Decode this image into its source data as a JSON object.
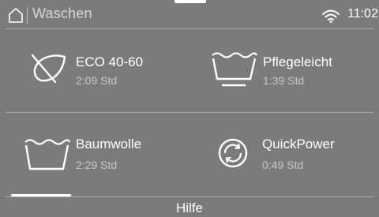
{
  "header": {
    "icon": "home-icon",
    "title": "Waschen",
    "wifi_icon": "wifi-icon",
    "clock": "11:02"
  },
  "programs": [
    {
      "icon": "leaf-icon",
      "name": "ECO 40-60",
      "duration": "2:09 Std"
    },
    {
      "icon": "easy-care-tub-icon",
      "name": "Pflegeleicht",
      "duration": "1:39 Std"
    },
    {
      "icon": "cotton-tub-icon",
      "name": "Baumwolle",
      "duration": "2:29 Std"
    },
    {
      "icon": "quickpower-icon",
      "name": "QuickPower",
      "duration": "0:49 Std"
    }
  ],
  "footer": {
    "help_label": "Hilfe"
  },
  "colors": {
    "background": "#7b7b7b",
    "text": "#ffffff",
    "secondary_text": "#c8c8c8",
    "divider": "#a8a8a8"
  }
}
